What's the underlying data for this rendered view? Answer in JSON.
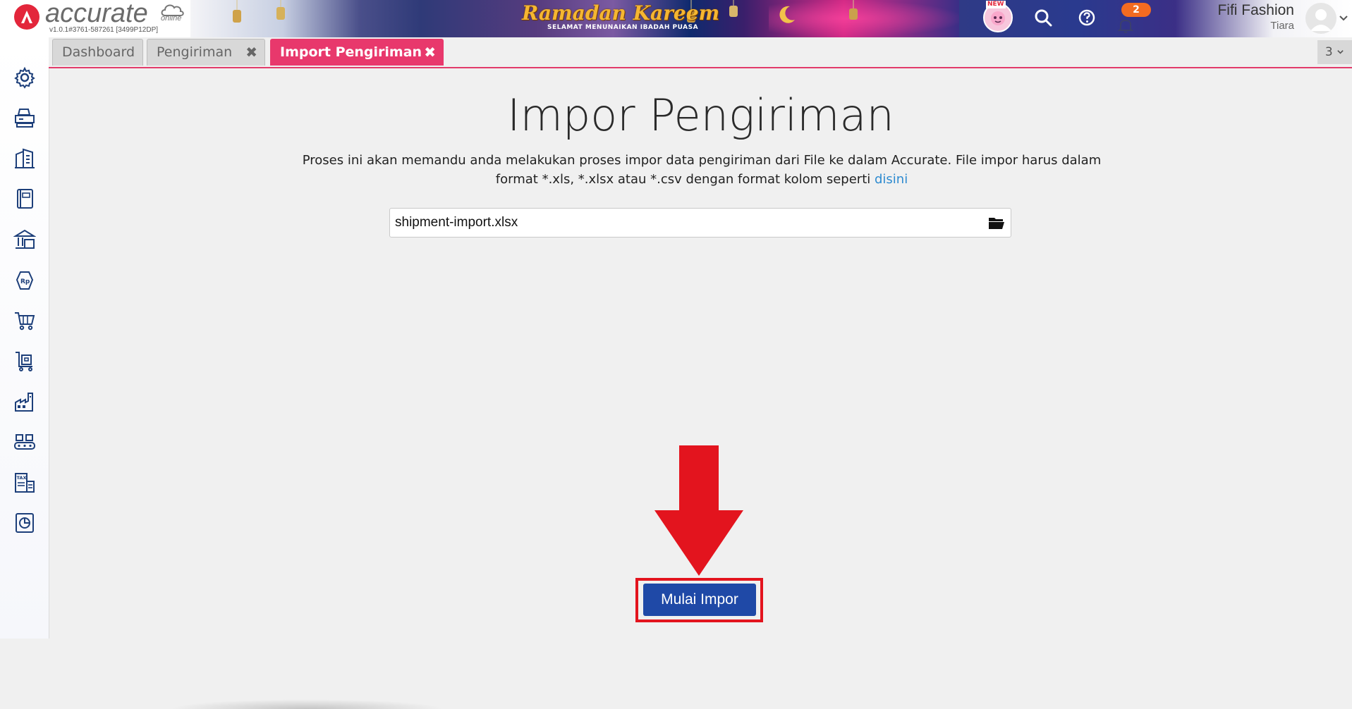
{
  "header": {
    "logo_text": "accurate",
    "logo_suffix": "online",
    "version": "v1.0.1#3761-587261 [3499P12DP]",
    "banner_title": "Ramadan Kareem",
    "banner_subtitle": "SELAMAT MENUNAIKAN IBADAH PUASA",
    "new_badge": "NEW",
    "notification_count": "2",
    "user_company": "Fifi Fashion",
    "user_name": "Tiara"
  },
  "sidebar": {
    "icons": [
      "gear-icon",
      "printer-icon",
      "building-icon",
      "book-icon",
      "bank-icon",
      "price-tag-icon",
      "cart-icon",
      "delivery-cart-icon",
      "factory-icon",
      "conveyor-icon",
      "tax-icon",
      "report-icon"
    ]
  },
  "tabs": [
    {
      "label": "Dashboard",
      "closable": false,
      "active": false
    },
    {
      "label": "Pengiriman",
      "closable": true,
      "active": false
    },
    {
      "label": "Import Pengiriman",
      "closable": true,
      "active": true
    }
  ],
  "tab_count": "3",
  "tab_close_glyph": "✖",
  "main": {
    "title": "Impor Pengiriman",
    "description_part1": "Proses ini akan memandu anda melakukan proses impor data pengiriman dari File ke dalam Accurate. File impor harus dalam format *.xls, *.xlsx atau *.csv dengan format kolom seperti ",
    "description_link": "disini",
    "file_value": "shipment-import.xlsx",
    "start_button": "Mulai Impor"
  },
  "colors": {
    "accent_pink": "#e8386c",
    "button_blue": "#1f49a7",
    "annotation_red": "#e3141e",
    "link_blue": "#2e8bd0"
  }
}
